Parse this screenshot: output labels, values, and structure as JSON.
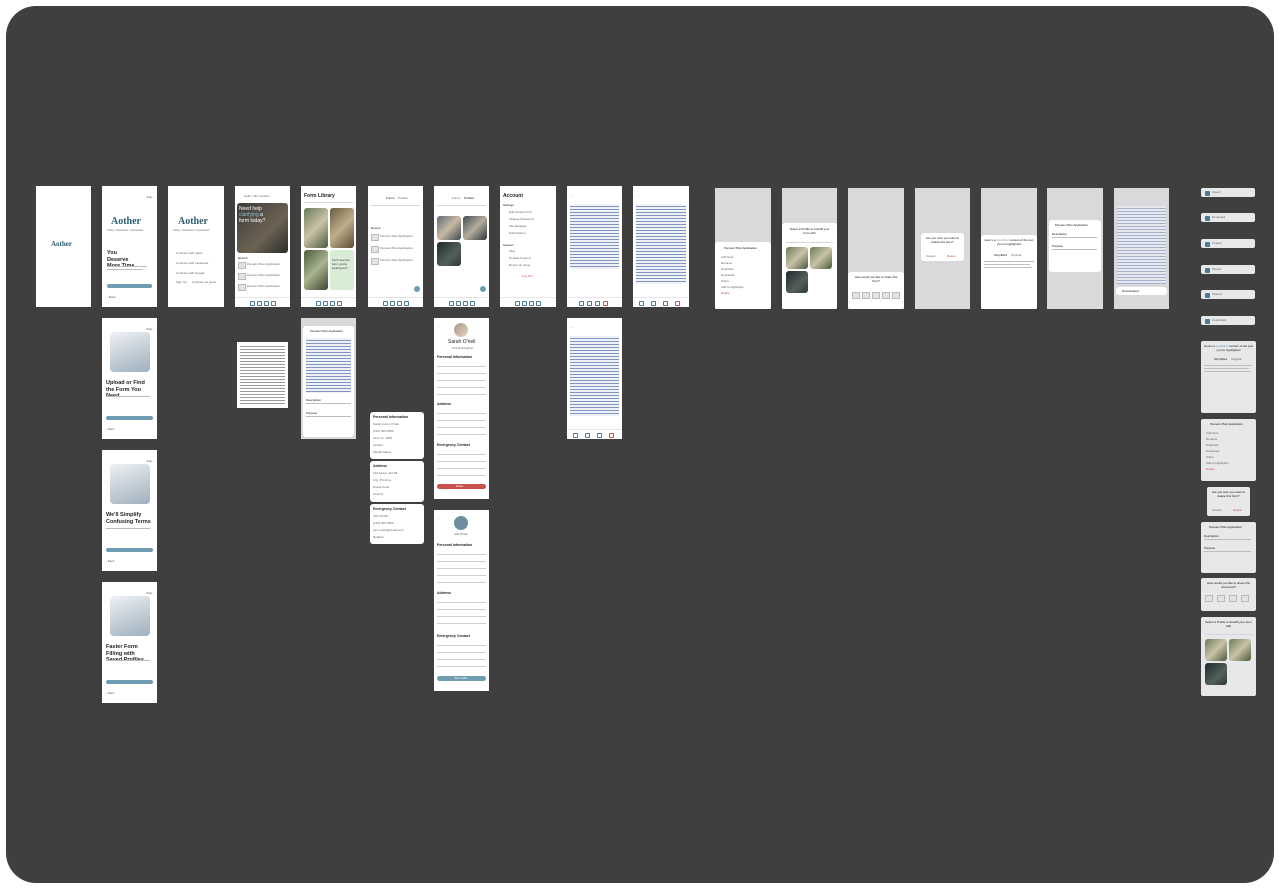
{
  "brand": {
    "app_name": "Aother",
    "tagline": "Clarity • Assistance • Connection"
  },
  "onboarding": [
    {
      "title": "You Deserve More Time",
      "button": "Get Started",
      "skip": "Skip ›",
      "back": "‹ Back"
    },
    {
      "title": "Upload or Find the Form You Need",
      "button": "Get Started",
      "skip": "Skip ›",
      "back": "‹ Back"
    },
    {
      "title": "We'll Simplify Confusing Terms",
      "button": "Start Simplifying",
      "skip": "Skip ›",
      "back": "‹ Back"
    },
    {
      "title": "Faster Form Filling with Saved Profiles",
      "button": "Get Started",
      "skip": "Skip ›",
      "back": "‹ Back"
    }
  ],
  "login": {
    "apple": "Continue with Apple",
    "facebook": "Continue with Facebook",
    "google": "Continue with Google",
    "signup": "Sign Up",
    "guest": "Continue as guest"
  },
  "home": {
    "greeting": "Hello, Ollie Jenkins",
    "hero_prefix": "Need help ",
    "hero_highlight": "clarifying",
    "hero_suffix": " a form today?",
    "recent_label": "Recent",
    "items": [
      "Pension Plan Application",
      "Pension Plan Application",
      "Pension Plan Application"
    ]
  },
  "library": {
    "title": "Form Library",
    "card_text": "Can't see the form you're looking for?"
  },
  "saved": {
    "tab1": "Forms",
    "tab2": "Profiles",
    "recent_label": "Recent",
    "items": [
      "Pension Plan Application",
      "Pension Plan Application",
      "Pension Plan Application"
    ]
  },
  "profiles_screen": {
    "tab1": "Forms",
    "tab2": "Profiles"
  },
  "account": {
    "title": "Account",
    "settings_label": "Settings",
    "settings_items": [
      "Edit Account Info",
      "Change Password",
      "File Manager",
      "Subscription"
    ],
    "support_label": "Support",
    "support_items": [
      "FAQ",
      "Contact Support",
      "Report an Issue"
    ],
    "logout": "Log Out"
  },
  "form_detail": {
    "title": "Pension Plan Application",
    "description_label": "Description",
    "purpose_label": "Purpose"
  },
  "profile": {
    "name": "Sarah O'neil",
    "relation": "Grand Daughter",
    "personal_label": "Personal Information",
    "address_label": "Address",
    "emergency_label": "Emergency Contact",
    "delete": "Delete",
    "save": "Save Profile",
    "new_name": "Add Photo"
  },
  "field_lists": [
    {
      "title": "Personal Information",
      "fields": [
        "Sarah Jenny O'Neil",
        "(123) 456-7890",
        "June 12, 1993",
        "Gender",
        "Marital Status"
      ]
    },
    {
      "title": "Address",
      "fields": [
        "123 Street, Apt 4B",
        "City, Province",
        "Postal Code",
        "Country"
      ]
    },
    {
      "title": "Emergency Contact",
      "fields": [
        "John Smith",
        "(123) 456-7890",
        "john.smith@email.com",
        "Relation"
      ]
    }
  ],
  "overlays": {
    "menu_title": "Pension Plan Application",
    "menu_items": [
      "Add Note",
      "Rename",
      "Duplicate",
      "Download",
      "Share",
      "Add to Highlights",
      "Delete"
    ],
    "autofill_title": "Select a Profile to Autofill your form with",
    "share_title": "How would you like to share this form?",
    "delete_title": "Are you sure you want to delete this form?",
    "cancel": "Cancel",
    "delete": "Delete",
    "simplified_prefix": "Here's a ",
    "simplified_highlight": "simplified",
    "simplified_suffix": " version of the text you've highlighted",
    "simplified_tab": "Simplified",
    "original_tab": "Original",
    "download_toast": "Downloaded"
  },
  "components": {
    "toasts": [
      "Saved",
      "Renamed",
      "Copied",
      "Moved",
      "Shared",
      "Duplicated"
    ],
    "share_title": "How would you like to share this document?",
    "delete_title": "Are you sure you want to delete this form?",
    "autofill_title": "Select a Profile to Autofill your form with"
  },
  "colors": {
    "canvas": "#3f3f3f",
    "accent": "#6e9cb3",
    "brand": "#2f5d73",
    "danger": "#c9504d",
    "card_green": "#d9ecd6"
  }
}
